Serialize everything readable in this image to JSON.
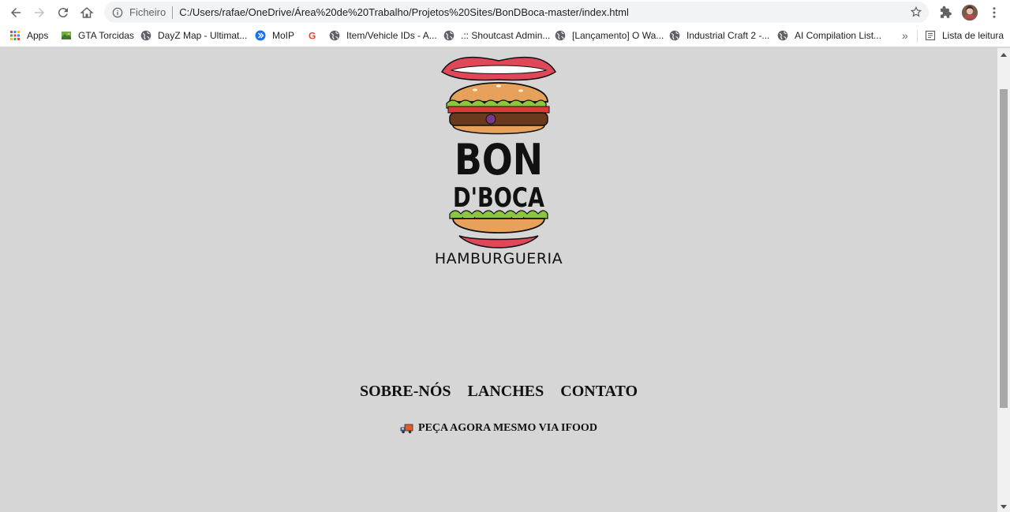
{
  "browser": {
    "omnibox": {
      "scheme_label": "Ficheiro",
      "url": "C:/Users/rafae/OneDrive/Área%20de%20Trabalho/Projetos%20Sites/BonDBoca-master/index.html"
    },
    "bookmarks": [
      {
        "label": "Apps",
        "icon": "apps-grid-icon"
      },
      {
        "label": "GTA Torcidas",
        "icon": "map-icon"
      },
      {
        "label": "DayZ Map - Ultimat...",
        "icon": "globe-icon"
      },
      {
        "label": "MoIP",
        "icon": "moip-icon"
      },
      {
        "label": "",
        "icon": "google-icon"
      },
      {
        "label": "Item/Vehicle IDs - A...",
        "icon": "globe-icon"
      },
      {
        "label": ".:: Shoutcast Admin...",
        "icon": "globe-icon"
      },
      {
        "label": "[Lançamento] O Wa...",
        "icon": "globe-icon"
      },
      {
        "label": "Industrial Craft 2 -...",
        "icon": "globe-icon"
      },
      {
        "label": "AI Compilation List...",
        "icon": "globe-icon"
      }
    ],
    "more_bookmarks": "»",
    "reading_list": "Lista de leitura"
  },
  "page": {
    "logo": {
      "line1": "BON",
      "line2": "D'BOCA",
      "subtitle": "HAMBURGUERIA"
    },
    "nav": {
      "about": "SOBRE-NÓS",
      "menu": "LANCHES",
      "contact": "CONTATO"
    },
    "order_cta": "PEÇA AGORA MESMO VIA IFOOD"
  },
  "colors": {
    "page_bg": "#d6d6d6",
    "bun": "#e8a15a",
    "lips": "#e0485a",
    "lettuce": "#8cc63f",
    "cheese": "#f2c230",
    "patty": "#6b3a1e"
  }
}
